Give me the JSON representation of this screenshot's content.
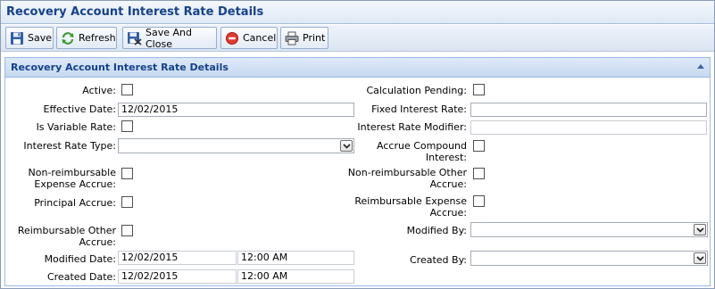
{
  "window": {
    "title": "Recovery Account Interest Rate Details"
  },
  "toolbar": {
    "save": "Save",
    "refresh": "Refresh",
    "save_close": "Save And Close",
    "cancel": "Cancel",
    "print": "Print"
  },
  "panel": {
    "title": "Recovery Account Interest Rate Details"
  },
  "form": {
    "active": {
      "label": "Active:",
      "checked": false
    },
    "effective_date": {
      "label": "Effective Date:",
      "value": "12/02/2015"
    },
    "is_variable_rate": {
      "label": "Is Variable Rate:",
      "checked": false
    },
    "interest_rate_type": {
      "label": "Interest Rate Type:",
      "value": ""
    },
    "non_reimb_expense_accrue": {
      "label1": "Non-reimbursable",
      "label2": "Expense Accrue:",
      "checked": false
    },
    "principal_accrue": {
      "label": "Principal Accrue:",
      "checked": false
    },
    "reimb_other_accrue": {
      "label1": "Reimbursable Other",
      "label2": "Accrue:",
      "checked": false
    },
    "modified_date": {
      "label": "Modified Date:",
      "date": "12/02/2015",
      "time": "12:00 AM"
    },
    "created_date": {
      "label": "Created Date:",
      "date": "12/02/2015",
      "time": "12:00 AM"
    },
    "calculation_pending": {
      "label": "Calculation Pending:",
      "checked": false
    },
    "fixed_interest_rate": {
      "label": "Fixed Interest Rate:",
      "value": ""
    },
    "interest_rate_modifier": {
      "label": "Interest Rate Modifier:",
      "value": ""
    },
    "accrue_compound_interest": {
      "label1": "Accrue Compound",
      "label2": "Interest:",
      "checked": false
    },
    "non_reimb_other_accrue": {
      "label1": "Non-reimbursable Other",
      "label2": "Accrue:",
      "checked": false
    },
    "reimb_expense_accrue": {
      "label1": "Reimbursable Expense",
      "label2": "Accrue:",
      "checked": false
    },
    "modified_by": {
      "label": "Modified By:",
      "value": ""
    },
    "created_by": {
      "label": "Created By:",
      "value": ""
    }
  }
}
